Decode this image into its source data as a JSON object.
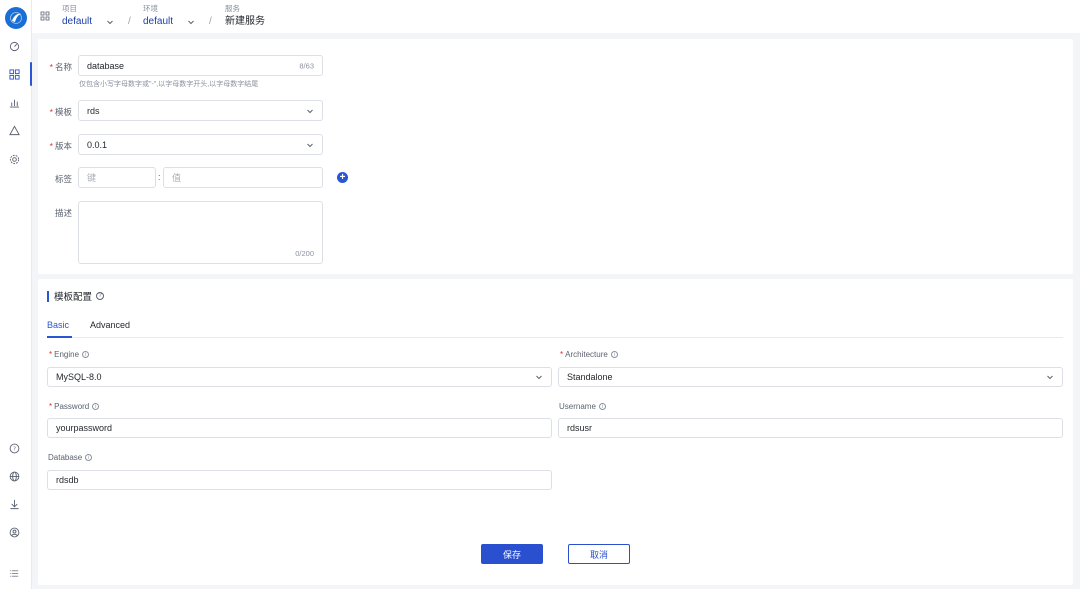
{
  "header": {
    "crumbs": [
      {
        "label": "项目",
        "value": "default"
      },
      {
        "label": "环境",
        "value": "default"
      },
      {
        "label": "服务",
        "value": "新建服务"
      }
    ]
  },
  "form": {
    "name": {
      "label": "名称",
      "value": "database",
      "counter": "8/63",
      "hint": "仅包含小写字母数字或\"-\",以字母数字开头,以字母数字结尾"
    },
    "template": {
      "label": "模板",
      "value": "rds"
    },
    "version": {
      "label": "版本",
      "value": "0.0.1"
    },
    "tags": {
      "label": "标签",
      "key_placeholder": "键",
      "value_placeholder": "值",
      "colon": ":"
    },
    "description": {
      "label": "描述",
      "counter": "0/200"
    }
  },
  "template_config": {
    "title": "模板配置",
    "tabs": [
      "Basic",
      "Advanced"
    ],
    "fields": {
      "engine": {
        "label": "Engine",
        "value": "MySQL-8.0",
        "required": true
      },
      "architecture": {
        "label": "Architecture",
        "value": "Standalone",
        "required": true
      },
      "password": {
        "label": "Password",
        "value": "yourpassword",
        "required": true
      },
      "username": {
        "label": "Username",
        "value": "rdsusr",
        "required": false
      },
      "database": {
        "label": "Database",
        "value": "rdsdb",
        "required": false
      }
    }
  },
  "actions": {
    "save": "保存",
    "cancel": "取消"
  },
  "colors": {
    "primary": "#2a4fcf",
    "required": "#d93026",
    "logo": "#1a6fd4"
  },
  "sidebar_icons": [
    "dashboard-icon",
    "apps-grid-icon",
    "chart-icon",
    "warning-icon",
    "settings-icon",
    "help-icon",
    "globe-icon",
    "download-icon",
    "user-icon",
    "list-icon"
  ]
}
